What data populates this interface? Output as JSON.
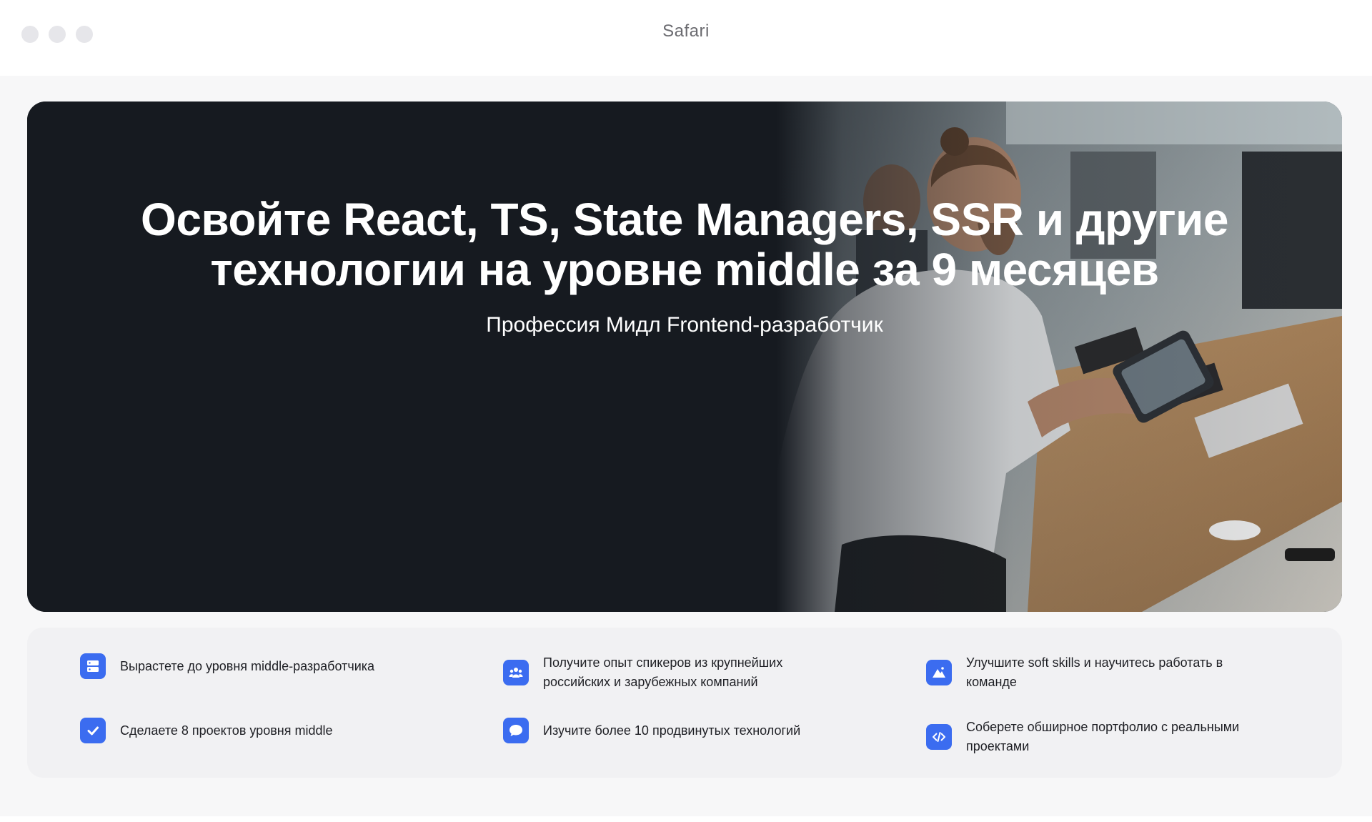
{
  "window": {
    "title": "Safari"
  },
  "hero": {
    "title": "Освойте React, TS, State Managers, SSR и другие технологии на уровне middle за 9 месяцев",
    "subtitle": "Профессия Мидл Frontend-разработчик"
  },
  "features": {
    "items": [
      {
        "icon": "server-icon",
        "text": "Вырастете до уровня middle-разработчика"
      },
      {
        "icon": "team-icon",
        "text": "Получите опыт спикеров из крупнейших российских и зарубежных компаний"
      },
      {
        "icon": "mountain-icon",
        "text": "Улучшите soft skills и научитесь работать в команде"
      },
      {
        "icon": "check-icon",
        "text": "Сделаете 8 проектов уровня middle"
      },
      {
        "icon": "chat-icon",
        "text": "Изучите более 10 продвинутых технологий"
      },
      {
        "icon": "code-icon",
        "text": "Соберете обширное портфолио с реальными проектами"
      }
    ]
  },
  "colors": {
    "accent": "#3b6cf0",
    "hero_background": "#161a20",
    "page_background": "#f7f7f8",
    "features_background": "#f1f1f3"
  }
}
